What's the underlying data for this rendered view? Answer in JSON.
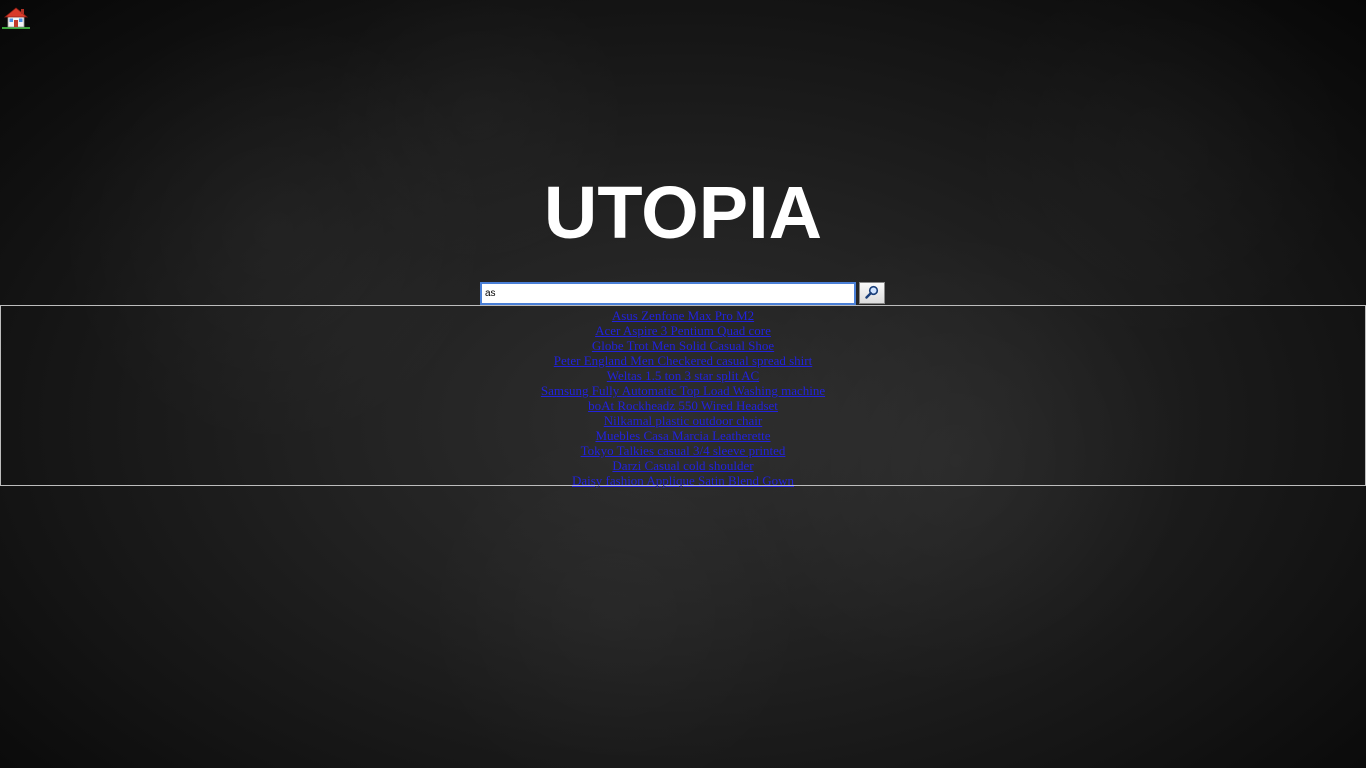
{
  "header": {
    "home_icon": "house-icon"
  },
  "logo": {
    "title": "UTOPIA"
  },
  "search": {
    "value": "as",
    "button_icon": "magnifier-icon"
  },
  "results": [
    "Asus Zenfone Max Pro M2",
    "Acer Aspire 3 Pentium Quad core",
    "Globe Trot Men Solid Casual Shoe",
    "Peter England Men Checkered casual spread shirt",
    "Weltas 1.5 ton 3 star split AC",
    "Samsung Fully Automatic Top Load Washing machine",
    "boAt Rockheadz 550 Wired Headset",
    "Nilkamal plastic outdoor chair",
    "Muebles Casa Marcia Leatherette",
    "Tokyo Talkies casual 3/4 sleeve printed",
    "Darzi Casual cold shoulder",
    "Daisy fashion Applique Satin Blend Gown"
  ],
  "colors": {
    "link": "#2222dd",
    "logo": "#ffffff",
    "input_border": "#4a7fd6"
  }
}
